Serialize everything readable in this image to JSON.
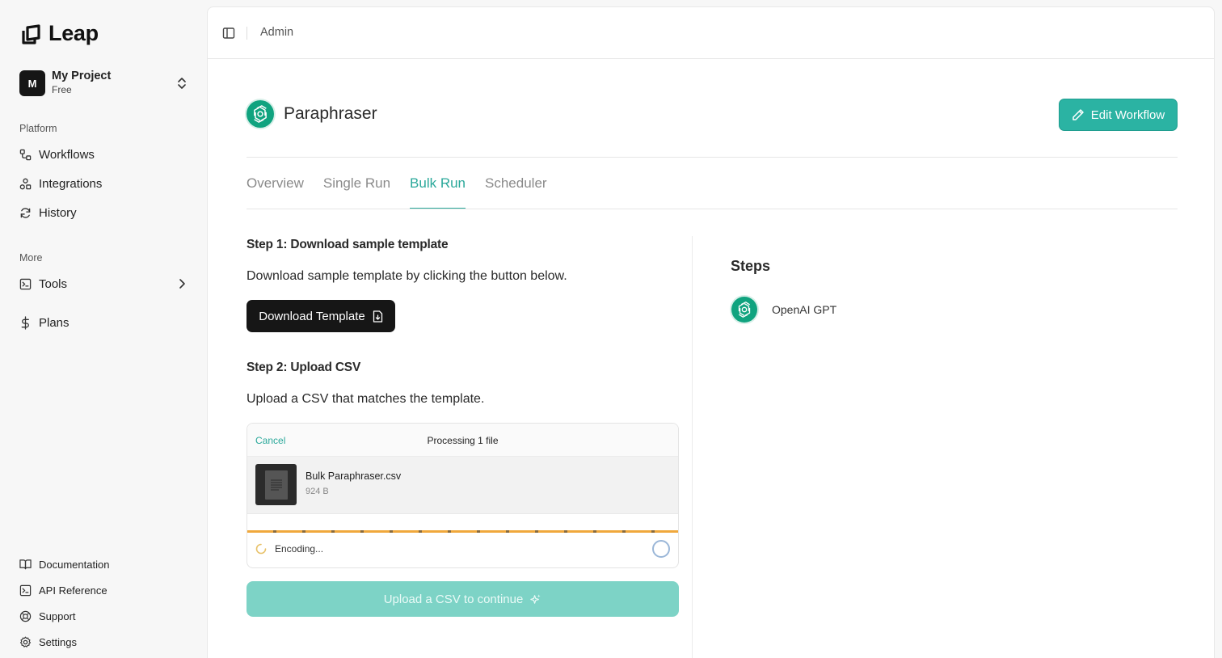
{
  "brand": {
    "name": "Leap"
  },
  "project": {
    "initial": "M",
    "name": "My Project",
    "plan": "Free"
  },
  "sidebar": {
    "platform_label": "Platform",
    "platform_items": [
      {
        "label": "Workflows",
        "icon": "workflow-icon"
      },
      {
        "label": "Integrations",
        "icon": "integrations-icon"
      },
      {
        "label": "History",
        "icon": "refresh-icon"
      }
    ],
    "more_label": "More",
    "tools_label": "Tools",
    "plans_label": "Plans",
    "bottom_items": [
      {
        "label": "Documentation",
        "icon": "book-icon"
      },
      {
        "label": "API Reference",
        "icon": "terminal-icon"
      },
      {
        "label": "Support",
        "icon": "lifebuoy-icon"
      },
      {
        "label": "Settings",
        "icon": "gear-icon"
      }
    ]
  },
  "topbar": {
    "breadcrumb": "Admin"
  },
  "workflow": {
    "title": "Paraphraser",
    "edit_label": "Edit Workflow"
  },
  "tabs": [
    {
      "label": "Overview",
      "active": false
    },
    {
      "label": "Single Run",
      "active": false
    },
    {
      "label": "Bulk Run",
      "active": true
    },
    {
      "label": "Scheduler",
      "active": false
    }
  ],
  "bulk": {
    "step1_title": "Step 1: Download sample template",
    "step1_desc": "Download sample template by clicking the button below.",
    "download_label": "Download Template",
    "step2_title": "Step 2: Upload CSV",
    "step2_desc": "Upload a CSV that matches the template.",
    "uploader": {
      "cancel_label": "Cancel",
      "status": "Processing 1 file",
      "file_name": "Bulk Paraphraser.csv",
      "file_size": "924 B",
      "progress_status": "Encoding..."
    },
    "continue_label": "Upload a CSV to continue"
  },
  "steps_panel": {
    "title": "Steps",
    "items": [
      {
        "label": "OpenAI GPT"
      }
    ]
  },
  "colors": {
    "accent": "#2aa89a",
    "button_teal": "#2bb3a3",
    "openai_green": "#10a37f",
    "dark": "#161616"
  }
}
